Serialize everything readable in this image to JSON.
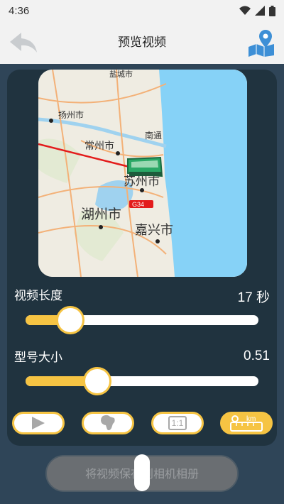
{
  "status": {
    "time": "4:36"
  },
  "header": {
    "title": "预览视频"
  },
  "map": {
    "labels": [
      "盐城市",
      "扬州市",
      "常州市",
      "南通",
      "苏州市",
      "湖州市",
      "嘉兴市"
    ],
    "road_badge": "G34"
  },
  "video_length": {
    "label": "视频长度",
    "value": "17 秒",
    "level_fraction": 0.15
  },
  "model_size": {
    "label": "型号大小",
    "value": "0.51",
    "level_fraction": 0.28
  },
  "controls": {
    "scale_label": "1:1",
    "km_label": "km"
  },
  "save_button": {
    "label": "将视频保存到相机相册"
  },
  "colors": {
    "accent": "#f6c443",
    "panel": "#20333f",
    "background": "#2f4558"
  }
}
